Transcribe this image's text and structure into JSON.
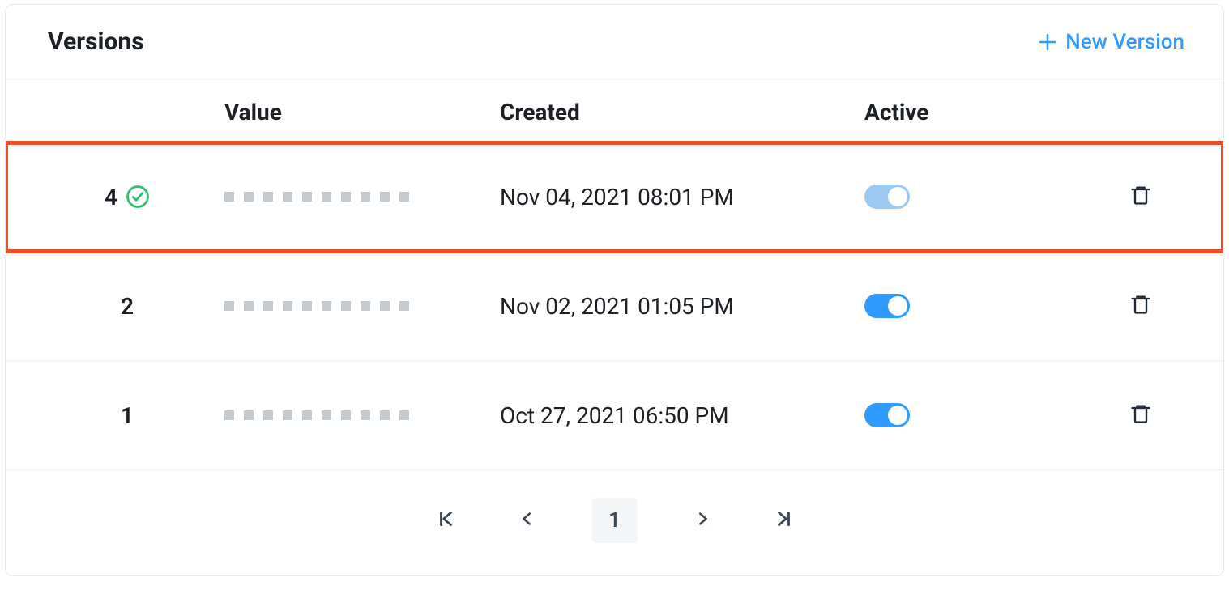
{
  "header": {
    "title": "Versions",
    "new_button_label": "New Version"
  },
  "columns": {
    "version": "",
    "value": "Value",
    "created": "Created",
    "active": "Active"
  },
  "rows": [
    {
      "version": "4",
      "has_check": true,
      "created": "Nov 04, 2021 08:01 PM",
      "active": true,
      "toggle_dim": true,
      "highlight": true
    },
    {
      "version": "2",
      "has_check": false,
      "created": "Nov 02, 2021 01:05 PM",
      "active": true,
      "toggle_dim": false,
      "highlight": false
    },
    {
      "version": "1",
      "has_check": false,
      "created": "Oct 27, 2021 06:50 PM",
      "active": true,
      "toggle_dim": false,
      "highlight": false
    }
  ],
  "pagination": {
    "current_page": "1"
  }
}
